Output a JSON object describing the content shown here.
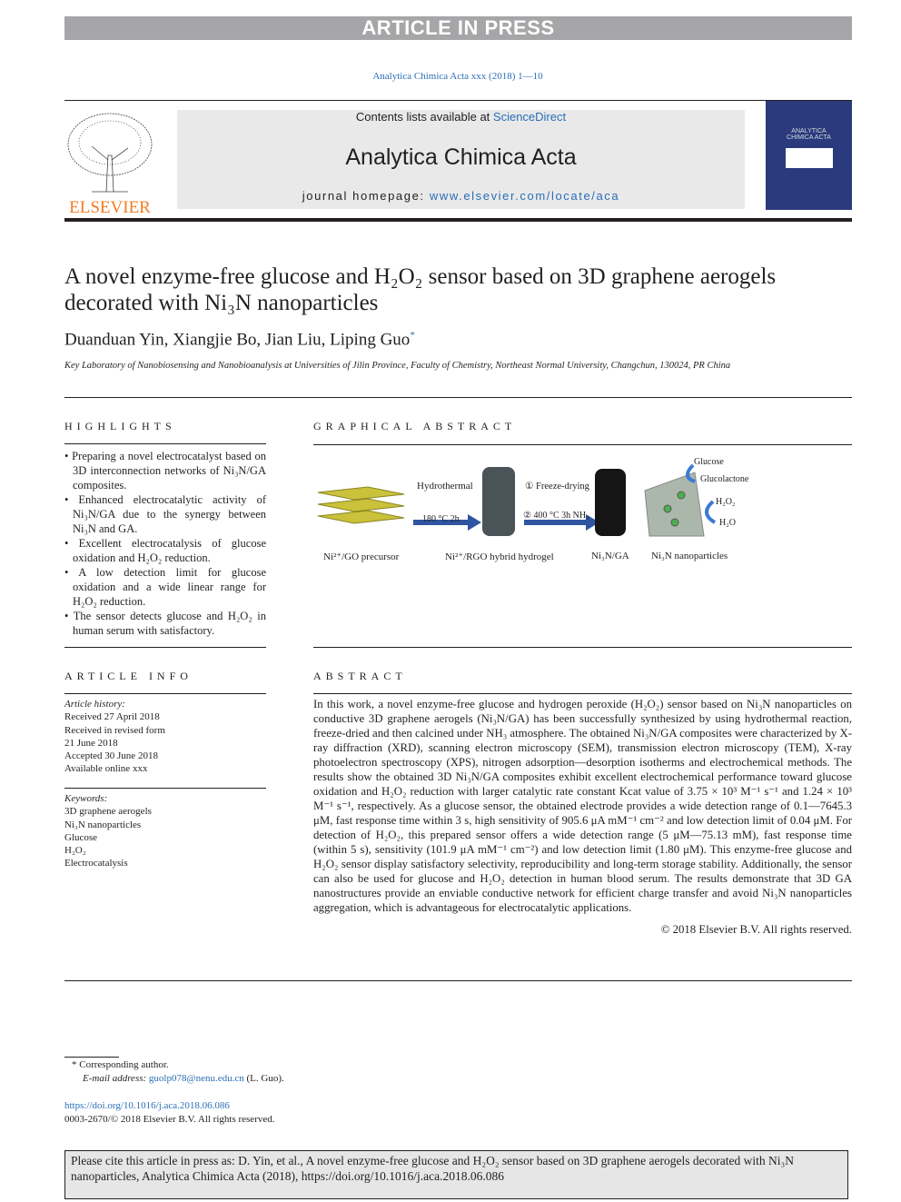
{
  "banner": "ARTICLE IN PRESS",
  "journal_ref": "Analytica Chimica Acta xxx (2018) 1—10",
  "masthead": {
    "contents_prefix": "Contents lists available at ",
    "sciencedirect": "ScienceDirect",
    "journal_name": "Analytica Chimica Acta",
    "homepage_prefix": "journal homepage: ",
    "homepage_url": "www.elsevier.com/locate/aca",
    "publisher_logo": "ELSEVIER",
    "cover_title": "ANALYTICA CHIMICA ACTA"
  },
  "title": "A novel enzyme-free glucose and H₂O₂ sensor based on 3D graphene aerogels decorated with Ni₃N nanoparticles",
  "authors": "Duanduan Yin, Xiangjie Bo, Jian Liu, Liping Guo",
  "corresponding_mark": "*",
  "affiliation": "Key Laboratory of Nanobiosensing and Nanobioanalysis at Universities of Jilin Province, Faculty of Chemistry, Northeast Normal University, Changchun, 130024, PR China",
  "highlights": {
    "heading": "HIGHLIGHTS",
    "items": [
      "Preparing a novel electrocatalyst based on 3D interconnection networks of Ni₃N/GA composites.",
      "Enhanced electrocatalytic activity of Ni₃N/GA due to the synergy between Ni₃N and GA.",
      "Excellent electrocatalysis of glucose oxidation and H₂O₂ reduction.",
      "A low detection limit for glucose oxidation and a wide linear range for H₂O₂ reduction.",
      "The sensor detects glucose and H₂O₂ in human serum with satisfactory."
    ]
  },
  "graphical_abstract": {
    "heading": "GRAPHICAL ABSTRACT",
    "labels": {
      "step1_top": "Hydrothermal",
      "step1_bottom": "180 °C  2h",
      "step2_top": "① Freeze-drying",
      "step2_bottom": "② 400 °C  3h NH₃",
      "glucose": "Glucose",
      "glucolactone": "Glucolactone",
      "h2o2": "H₂O₂",
      "h2o": "H₂O",
      "precursor": "Ni²⁺/GO precursor",
      "hydrogel": "Ni²⁺/RGO hybrid hydrogel",
      "composite": "Ni₃N/GA",
      "nanoparticles": "Ni₃N nanoparticles"
    }
  },
  "article_info": {
    "heading": "ARTICLE INFO",
    "history_label": "Article history:",
    "history": [
      "Received 27 April 2018",
      "Received in revised form",
      "21 June 2018",
      "Accepted 30 June 2018",
      "Available online xxx"
    ],
    "keywords_label": "Keywords:",
    "keywords": [
      "3D graphene aerogels",
      "Ni₃N nanoparticles",
      "Glucose",
      "H₂O₂",
      "Electrocatalysis"
    ]
  },
  "abstract": {
    "heading": "ABSTRACT",
    "text": "In this work, a novel enzyme-free glucose and hydrogen peroxide (H₂O₂) sensor based on Ni₃N nanoparticles on conductive 3D graphene aerogels (Ni₃N/GA) has been successfully synthesized by using hydrothermal reaction, freeze-dried and then calcined under NH₃ atmosphere. The obtained Ni₃N/GA composites were characterized by X-ray diffraction (XRD), scanning electron microscopy (SEM), transmission electron microscopy (TEM), X-ray photoelectron spectroscopy (XPS), nitrogen adsorption—desorption isotherms and electrochemical methods. The results show the obtained 3D Ni₃N/GA composites exhibit excellent electrochemical performance toward glucose oxidation and H₂O₂ reduction with larger catalytic rate constant Kcat value of 3.75 × 10³ M⁻¹ s⁻¹ and 1.24 × 10³ M⁻¹ s⁻¹, respectively. As a glucose sensor, the obtained electrode provides a wide detection range of 0.1—7645.3 μM, fast response time within 3 s, high sensitivity of 905.6 μA mM⁻¹ cm⁻² and low detection limit of 0.04 μM. For detection of H₂O₂, this prepared sensor offers a wide detection range (5 μM—75.13 mM), fast response time (within 5 s), sensitivity (101.9 μA mM⁻¹ cm⁻²) and low detection limit (1.80 μM). This enzyme-free glucose and H₂O₂ sensor display satisfactory selectivity, reproducibility and long-term storage stability. Additionally, the sensor can also be used for glucose and H₂O₂ detection in human blood serum. The results demonstrate that 3D GA nanostructures provide an enviable conductive network for efficient charge transfer and avoid Ni₃N nanoparticles aggregation, which is advantageous for electrocatalytic applications.",
    "copyright": "© 2018 Elsevier B.V. All rights reserved."
  },
  "footnotes": {
    "corresponding": "* Corresponding author.",
    "email_label": "E-mail address: ",
    "email": "guolp078@nenu.edu.cn",
    "email_suffix": " (L. Guo).",
    "doi": "https://doi.org/10.1016/j.aca.2018.06.086",
    "issn": "0003-2670/© 2018 Elsevier B.V. All rights reserved."
  },
  "citation": "Please cite this article in press as: D. Yin, et al., A novel enzyme-free glucose and H₂O₂ sensor based on 3D graphene aerogels decorated with Ni₃N nanoparticles, Analytica Chimica Acta (2018), https://doi.org/10.1016/j.aca.2018.06.086",
  "colors": {
    "link": "#2b6fb6",
    "banner_gray": "#a6a6a8",
    "elsevier_orange": "#f47b20"
  }
}
